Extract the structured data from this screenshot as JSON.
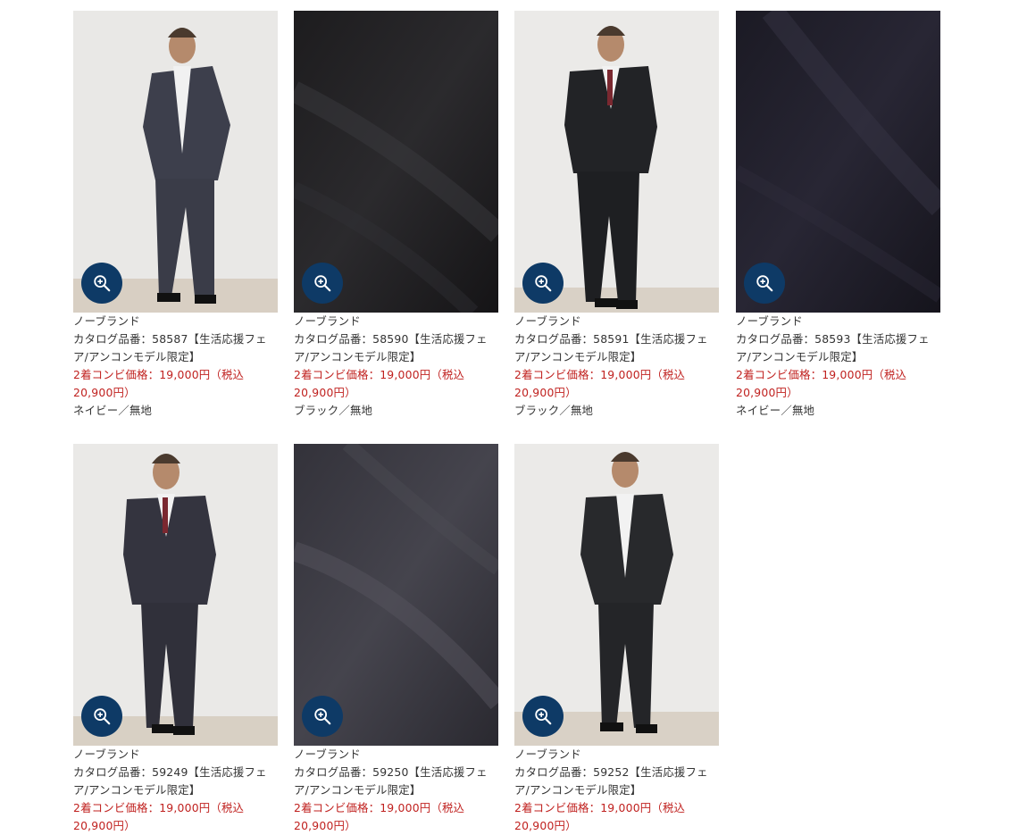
{
  "accent_color": "#0e3a66",
  "price_color": "#c0211f",
  "products": [
    {
      "brand": "ノーブランド",
      "title": "カタログ品番：58587【生活応援フェア/アンコンモデル限定】",
      "price": "2着コンビ価格：19,000円（税込 20,900円）",
      "color": "ネイビー／無地",
      "image": "model-navy-single-breasted"
    },
    {
      "brand": "ノーブランド",
      "title": "カタログ品番：58590【生活応援フェア/アンコンモデル限定】",
      "price": "2着コンビ価格：19,000円（税込 20,900円）",
      "color": "ブラック／無地",
      "image": "fabric-black"
    },
    {
      "brand": "ノーブランド",
      "title": "カタログ品番：58591【生活応援フェア/アンコンモデル限定】",
      "price": "2着コンビ価格：19,000円（税込 20,900円）",
      "color": "ブラック／無地",
      "image": "model-black-double-breasted"
    },
    {
      "brand": "ノーブランド",
      "title": "カタログ品番：58593【生活応援フェア/アンコンモデル限定】",
      "price": "2着コンビ価格：19,000円（税込 20,900円）",
      "color": "ネイビー／無地",
      "image": "fabric-navy"
    },
    {
      "brand": "ノーブランド",
      "title": "カタログ品番：59249【生活応援フェア/アンコンモデル限定】",
      "price": "2着コンビ価格：19,000円（税込 20,900円）",
      "color": "",
      "image": "model-navy-double-breasted"
    },
    {
      "brand": "ノーブランド",
      "title": "カタログ品番：59250【生活応援フェア/アンコンモデル限定】",
      "price": "2着コンビ価格：19,000円（税込 20,900円）",
      "color": "",
      "image": "fabric-charcoal"
    },
    {
      "brand": "ノーブランド",
      "title": "カタログ品番：59252【生活応援フェア/アンコンモデル限定】",
      "price": "2着コンビ価格：19,000円（税込 20,900円）",
      "color": "",
      "image": "model-black-single-breasted"
    }
  ]
}
